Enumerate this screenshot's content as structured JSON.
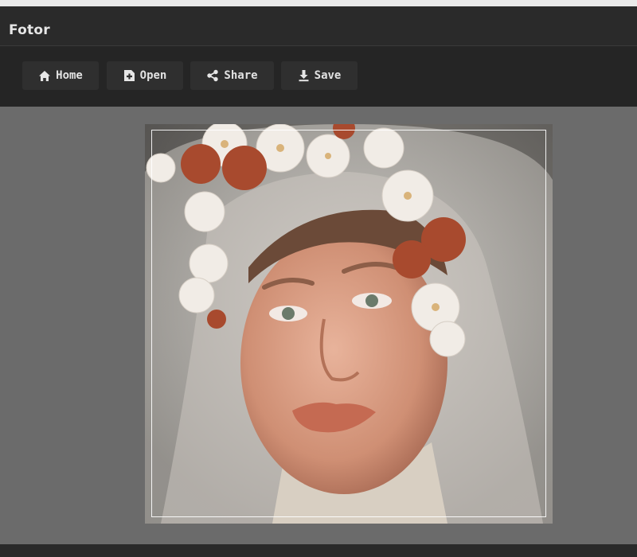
{
  "app": {
    "title": "Fotor"
  },
  "toolbar": {
    "home_label": "Home",
    "open_label": "Open",
    "share_label": "Share",
    "save_label": "Save"
  },
  "icons": {
    "home": "home-icon",
    "open": "add-file-icon",
    "share": "share-icon",
    "save": "download-icon"
  },
  "colors": {
    "titlebar": "#2a2a2a",
    "toolbar": "#252525",
    "canvas": "#6b6b6b",
    "button": "#2f2f2f",
    "text": "#e2e2e2"
  }
}
